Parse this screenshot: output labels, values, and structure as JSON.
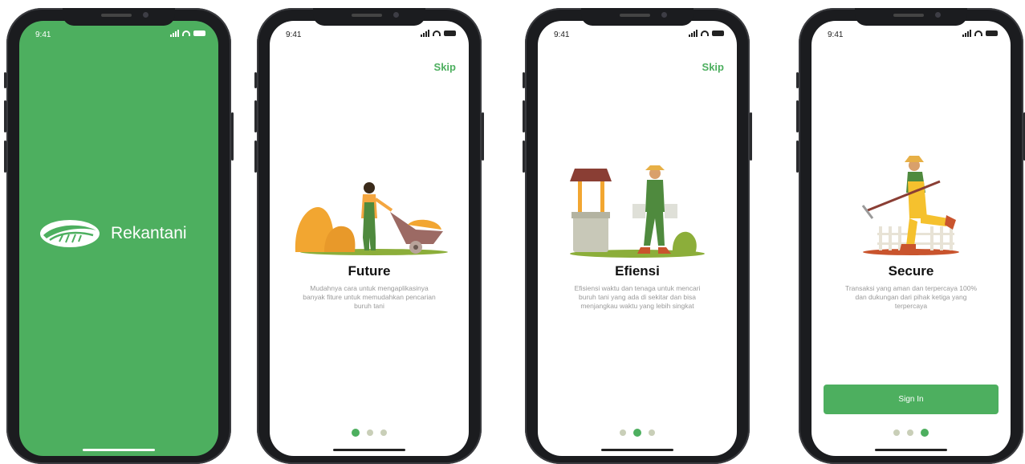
{
  "status_time": "9:41",
  "splash": {
    "brand": "Rekantani"
  },
  "onboarding": [
    {
      "skip": "Skip",
      "title": "Future",
      "description": "Mudahnya cara untuk mengaplikasinya banyak fiture untuk memudahkan pencarian buruh tani",
      "active_dot": 1
    },
    {
      "skip": "Skip",
      "title": "Efiensi",
      "description": "Efisiensi waktu dan tenaga untuk mencari buruh tani yang ada di sekitar dan bisa menjangkau waktu yang lebih singkat",
      "active_dot": 2
    },
    {
      "title": "Secure",
      "description": "Transaksi yang aman dan terpercaya 100% dan dukungan dari pihak ketiga yang terpercaya",
      "button": "Sign In",
      "active_dot": 3
    }
  ],
  "colors": {
    "brand_green": "#4daf5f",
    "dot_inactive": "#c9cfb8"
  },
  "icons": [
    "signal-icon",
    "wifi-icon",
    "battery-icon",
    "rekantani-logo-icon"
  ]
}
